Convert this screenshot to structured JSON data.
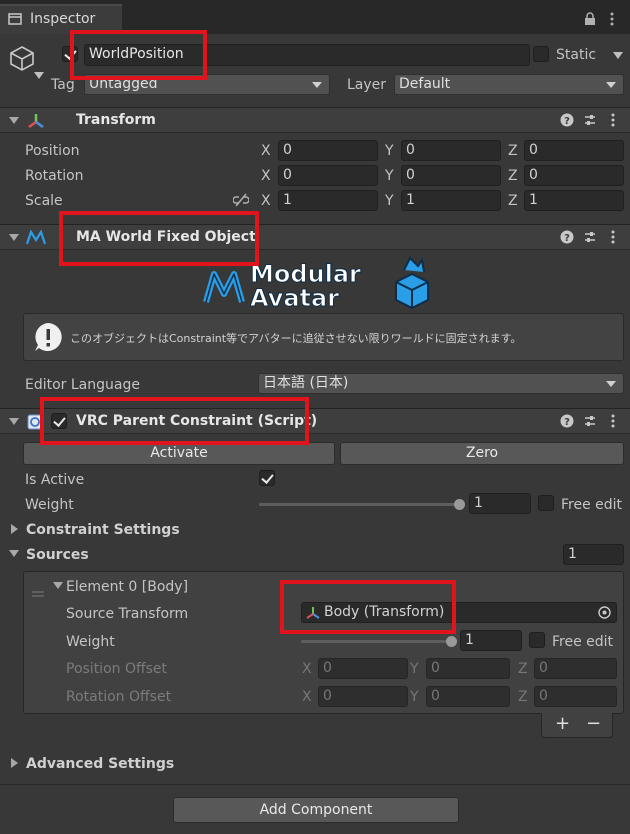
{
  "window": {
    "tab_title": "Inspector"
  },
  "object": {
    "name": "WorldPosition",
    "static_label": "Static",
    "tag_label": "Tag",
    "tag_value": "Untagged",
    "layer_label": "Layer",
    "layer_value": "Default"
  },
  "transform": {
    "title": "Transform",
    "rows": [
      {
        "label": "Position",
        "x": "0",
        "y": "0",
        "z": "0"
      },
      {
        "label": "Rotation",
        "x": "0",
        "y": "0",
        "z": "0"
      },
      {
        "label": "Scale",
        "x": "1",
        "y": "1",
        "z": "1"
      }
    ],
    "axes": {
      "x": "X",
      "y": "Y",
      "z": "Z"
    }
  },
  "ma_component": {
    "title": "MA World Fixed Object",
    "logo_line1": "Modular",
    "logo_line2": "Avatar",
    "info_message": "このオブジェクトはConstraint等でアバターに追従させない限りワールドに固定されます。",
    "language_label": "Editor Language",
    "language_value": "日本語 (日本)"
  },
  "vrc_constraint": {
    "title": "VRC Parent Constraint (Script)",
    "activate_label": "Activate",
    "zero_label": "Zero",
    "is_active_label": "Is Active",
    "weight_label": "Weight",
    "weight_value": "1",
    "weight_fraction": 1.0,
    "free_edit_label": "Free edit",
    "constraint_settings_label": "Constraint Settings",
    "sources_label": "Sources",
    "sources_count": "1",
    "element": {
      "title": "Element 0 [Body]",
      "source_transform_label": "Source Transform",
      "source_transform_value": "Body (Transform)",
      "weight_label": "Weight",
      "weight_value": "1",
      "weight_fraction": 1.0,
      "free_edit_label": "Free edit",
      "position_offset_label": "Position Offset",
      "position_offset": {
        "x": "0",
        "y": "0",
        "z": "0"
      },
      "rotation_offset_label": "Rotation Offset",
      "rotation_offset": {
        "x": "0",
        "y": "0",
        "z": "0"
      }
    },
    "add_label": "+",
    "remove_label": "−",
    "advanced_settings_label": "Advanced Settings"
  },
  "add_component_label": "Add Component",
  "colors": {
    "highlight": "#e0141c",
    "background": "#383838",
    "header": "#3e3e3e",
    "field": "#2a2a2a"
  },
  "icons": [
    "cube-icon",
    "lock-icon",
    "menu-icon",
    "transform-icon",
    "help-icon",
    "preset-icon",
    "more-icon",
    "ma-icon",
    "script-icon",
    "info-icon",
    "link-icon",
    "target-icon"
  ]
}
